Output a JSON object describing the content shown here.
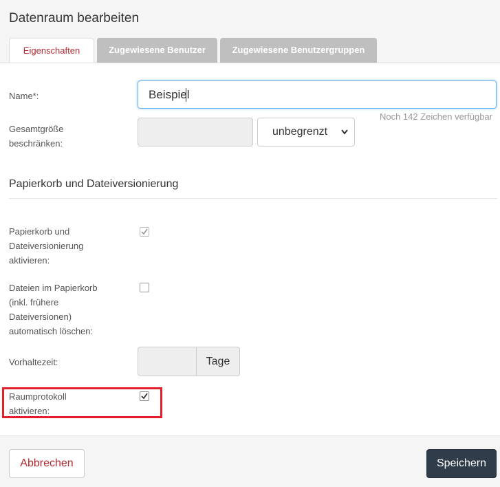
{
  "dialog": {
    "title": "Datenraum bearbeiten"
  },
  "tabs": [
    {
      "label": "Eigenschaften",
      "active": true
    },
    {
      "label": "Zugewiesene Benutzer",
      "active": false
    },
    {
      "label": "Zugewiesene Benutzergruppen",
      "active": false
    }
  ],
  "form": {
    "name": {
      "label": "Name*:",
      "value": "Beispiel",
      "hint": "Noch 142 Zeichen verfügbar"
    },
    "size_limit": {
      "label_line1": "Gesamtgröße",
      "label_line2": "beschränken:",
      "value": "",
      "unit_selected": "unbegrenzt"
    },
    "section_title": "Papierkorb und Dateiversionierung",
    "trash_enable": {
      "label_line1": "Papierkorb und",
      "label_line2": "Dateiversionierung",
      "label_line3": "aktivieren:",
      "checked": true,
      "disabled": true
    },
    "trash_autodelete": {
      "label_line1": "Dateien im Papierkorb",
      "label_line2": "(inkl. frühere",
      "label_line3": "Dateiversionen)",
      "label_line4": "automatisch löschen:",
      "checked": false
    },
    "retention": {
      "label": "Vorhaltezeit:",
      "value": "",
      "addon": "Tage"
    },
    "room_log": {
      "label_line1": "Raumprotokoll",
      "label_line2": "aktivieren:",
      "checked": true
    }
  },
  "footer": {
    "cancel_label": "Abbrechen",
    "save_label": "Speichern"
  },
  "colors": {
    "accent": "#b5282f",
    "primary_button": "#2f3c4a",
    "highlight": "#e3202a",
    "focus": "#66afe9"
  }
}
